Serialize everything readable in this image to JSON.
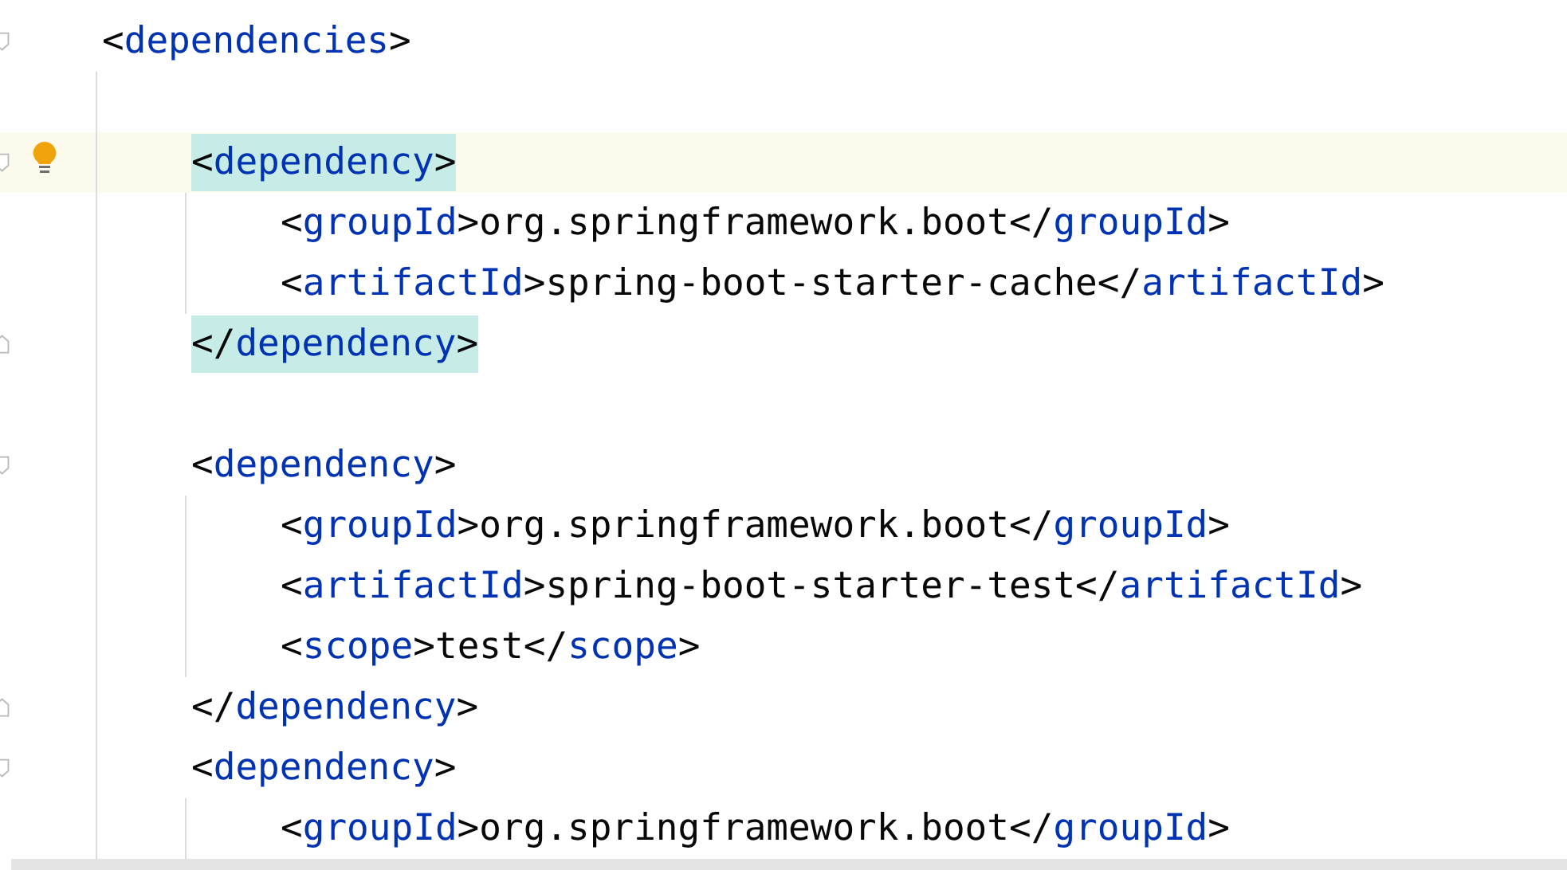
{
  "editor": {
    "lines": [
      {
        "kind": "code",
        "foldable": true,
        "tokens": [
          {
            "kind": "punct",
            "text": "<"
          },
          {
            "kind": "tag",
            "text": "dependencies"
          },
          {
            "kind": "punct",
            "text": ">"
          }
        ],
        "children": [
          {
            "kind": "blank"
          },
          {
            "kind": "code",
            "foldable": true,
            "current": true,
            "matched": true,
            "hint": true,
            "tokens": [
              {
                "kind": "punct",
                "text": "<"
              },
              {
                "kind": "tag",
                "text": "dependency"
              },
              {
                "kind": "punct",
                "text": ">"
              }
            ],
            "children": [
              {
                "kind": "code",
                "tokens": [
                  {
                    "kind": "punct",
                    "text": "<"
                  },
                  {
                    "kind": "tag",
                    "text": "groupId"
                  },
                  {
                    "kind": "punct",
                    "text": ">"
                  },
                  {
                    "kind": "text",
                    "text": "org.springframework.boot"
                  },
                  {
                    "kind": "punct",
                    "text": "</"
                  },
                  {
                    "kind": "tag",
                    "text": "groupId"
                  },
                  {
                    "kind": "punct",
                    "text": ">"
                  }
                ]
              },
              {
                "kind": "code",
                "tokens": [
                  {
                    "kind": "punct",
                    "text": "<"
                  },
                  {
                    "kind": "tag",
                    "text": "artifactId"
                  },
                  {
                    "kind": "punct",
                    "text": ">"
                  },
                  {
                    "kind": "text",
                    "text": "spring-boot-starter-cache"
                  },
                  {
                    "kind": "punct",
                    "text": "</"
                  },
                  {
                    "kind": "tag",
                    "text": "artifactId"
                  },
                  {
                    "kind": "punct",
                    "text": ">"
                  }
                ]
              }
            ]
          },
          {
            "kind": "code",
            "fold_end": true,
            "matched": true,
            "tokens": [
              {
                "kind": "punct",
                "text": "</"
              },
              {
                "kind": "tag",
                "text": "dependency"
              },
              {
                "kind": "punct",
                "text": ">"
              }
            ]
          },
          {
            "kind": "blank"
          },
          {
            "kind": "code",
            "foldable": true,
            "tokens": [
              {
                "kind": "punct",
                "text": "<"
              },
              {
                "kind": "tag",
                "text": "dependency"
              },
              {
                "kind": "punct",
                "text": ">"
              }
            ],
            "children": [
              {
                "kind": "code",
                "tokens": [
                  {
                    "kind": "punct",
                    "text": "<"
                  },
                  {
                    "kind": "tag",
                    "text": "groupId"
                  },
                  {
                    "kind": "punct",
                    "text": ">"
                  },
                  {
                    "kind": "text",
                    "text": "org.springframework.boot"
                  },
                  {
                    "kind": "punct",
                    "text": "</"
                  },
                  {
                    "kind": "tag",
                    "text": "groupId"
                  },
                  {
                    "kind": "punct",
                    "text": ">"
                  }
                ]
              },
              {
                "kind": "code",
                "tokens": [
                  {
                    "kind": "punct",
                    "text": "<"
                  },
                  {
                    "kind": "tag",
                    "text": "artifactId"
                  },
                  {
                    "kind": "punct",
                    "text": ">"
                  },
                  {
                    "kind": "text",
                    "text": "spring-boot-starter-test"
                  },
                  {
                    "kind": "punct",
                    "text": "</"
                  },
                  {
                    "kind": "tag",
                    "text": "artifactId"
                  },
                  {
                    "kind": "punct",
                    "text": ">"
                  }
                ]
              },
              {
                "kind": "code",
                "tokens": [
                  {
                    "kind": "punct",
                    "text": "<"
                  },
                  {
                    "kind": "tag",
                    "text": "scope"
                  },
                  {
                    "kind": "punct",
                    "text": ">"
                  },
                  {
                    "kind": "text",
                    "text": "test"
                  },
                  {
                    "kind": "punct",
                    "text": "</"
                  },
                  {
                    "kind": "tag",
                    "text": "scope"
                  },
                  {
                    "kind": "punct",
                    "text": ">"
                  }
                ]
              }
            ]
          },
          {
            "kind": "code",
            "fold_end": true,
            "tokens": [
              {
                "kind": "punct",
                "text": "</"
              },
              {
                "kind": "tag",
                "text": "dependency"
              },
              {
                "kind": "punct",
                "text": ">"
              }
            ]
          },
          {
            "kind": "code",
            "foldable": true,
            "tokens": [
              {
                "kind": "punct",
                "text": "<"
              },
              {
                "kind": "tag",
                "text": "dependency"
              },
              {
                "kind": "punct",
                "text": ">"
              }
            ],
            "children": [
              {
                "kind": "code",
                "tokens": [
                  {
                    "kind": "punct",
                    "text": "<"
                  },
                  {
                    "kind": "tag",
                    "text": "groupId"
                  },
                  {
                    "kind": "punct",
                    "text": ">"
                  },
                  {
                    "kind": "text",
                    "text": "org.springframework.boot"
                  },
                  {
                    "kind": "punct",
                    "text": "</"
                  },
                  {
                    "kind": "tag",
                    "text": "groupId"
                  },
                  {
                    "kind": "punct",
                    "text": ">"
                  }
                ]
              }
            ]
          }
        ]
      }
    ]
  }
}
